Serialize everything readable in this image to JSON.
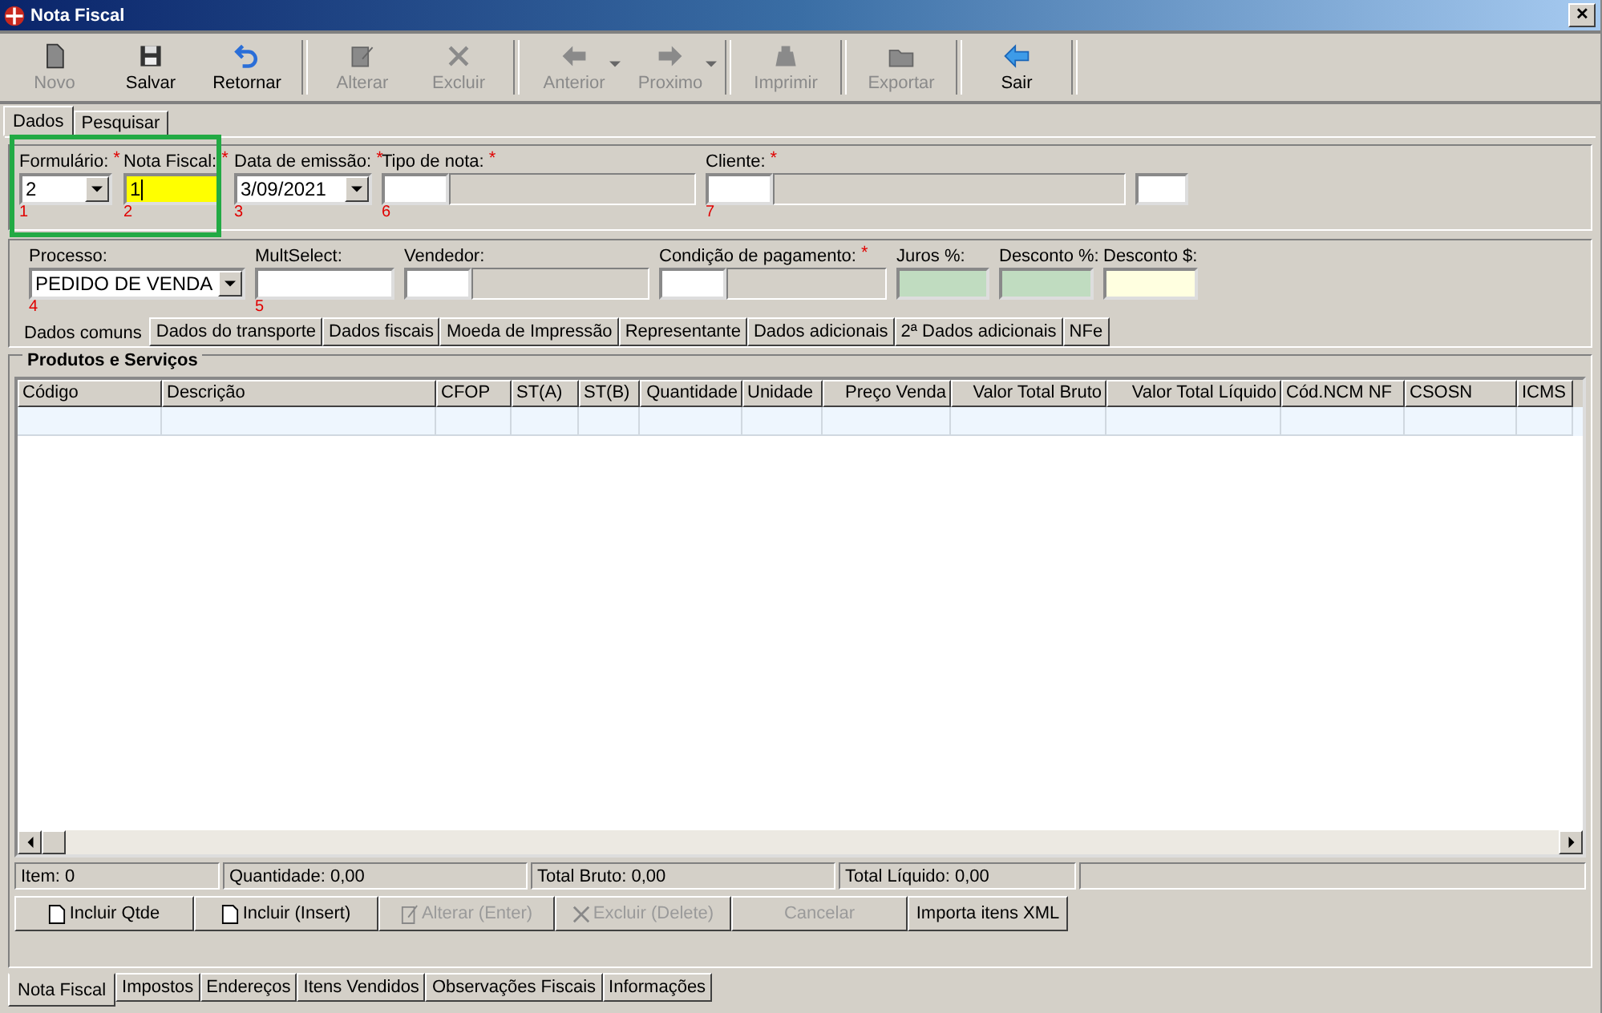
{
  "window": {
    "title": "Nota Fiscal",
    "close": "✕"
  },
  "toolbar": {
    "groups": [
      [
        {
          "label": "Novo",
          "kind": "doc",
          "disabled": true
        },
        {
          "label": "Salvar",
          "kind": "floppy",
          "disabled": false
        },
        {
          "label": "Retornar",
          "kind": "undo",
          "disabled": false
        }
      ],
      [
        {
          "label": "Alterar",
          "kind": "edit",
          "disabled": true
        },
        {
          "label": "Excluir",
          "kind": "x",
          "disabled": true
        }
      ],
      [
        {
          "label": "Anterior",
          "kind": "left",
          "disabled": true,
          "dropdown": true
        },
        {
          "label": "Proximo",
          "kind": "right",
          "disabled": true,
          "dropdown": true
        }
      ],
      [
        {
          "label": "Imprimir",
          "kind": "bag",
          "disabled": true
        }
      ],
      [
        {
          "label": "Exportar",
          "kind": "folder",
          "disabled": true
        }
      ],
      [
        {
          "label": "Sair",
          "kind": "back",
          "disabled": false
        }
      ]
    ]
  },
  "top_tabs": [
    {
      "label": "Dados",
      "selected": true
    },
    {
      "label": "Pesquisar",
      "selected": false
    }
  ],
  "header_fields": [
    {
      "label": "Formulário:",
      "kind": "combo",
      "value": "2",
      "mark": "*",
      "index": "1"
    },
    {
      "label": "Nota Fiscal:",
      "kind": "input",
      "value": "1",
      "color": "#ffff00",
      "focused": true,
      "mark": "*",
      "index": "2"
    },
    {
      "label": "Data de emissão:",
      "kind": "combo",
      "value": "3/09/2021",
      "mark": "*",
      "index": "3"
    },
    {
      "label": "Tipo de nota:",
      "kind": "split",
      "mark": "*",
      "index": "6"
    },
    {
      "label": "Cliente:",
      "kind": "split",
      "mark": "*",
      "index": "7"
    },
    {
      "kind": "input",
      "color": "#ffffff"
    }
  ],
  "detail_fields": [
    {
      "label": "Processo:",
      "kind": "combo",
      "value": "PEDIDO DE VENDA",
      "index": "4"
    },
    {
      "label": "MultSelect:",
      "kind": "input",
      "color": "#ffffff",
      "index": "5"
    },
    {
      "label": "Vendedor:",
      "kind": "split"
    },
    {
      "label": "Condição de pagamento:",
      "kind": "split",
      "mark": "*"
    },
    {
      "label": "Juros %:",
      "kind": "input",
      "color": "#c0dcc0"
    },
    {
      "label": "Desconto %:",
      "kind": "input",
      "color": "#c0dcc0"
    },
    {
      "label": "Desconto $:",
      "kind": "input",
      "color": "#ffffe0"
    }
  ],
  "detail_tabs": [
    {
      "label": "Dados comuns",
      "selected": true
    },
    {
      "label": "Dados do transporte",
      "selected": false
    },
    {
      "label": "Dados fiscais",
      "selected": false
    },
    {
      "label": "Moeda de Impressão",
      "selected": false
    },
    {
      "label": "Representante",
      "selected": false
    },
    {
      "label": "Dados adicionais",
      "selected": false
    },
    {
      "label": "2ª Dados adicionais",
      "selected": false
    },
    {
      "label": "NFe",
      "selected": false
    }
  ],
  "products": {
    "title": "Produtos e Serviços",
    "columns": [
      "Código",
      "Descrição",
      "CFOP",
      "ST(A)",
      "ST(B)",
      "Quantidade",
      "Unidade",
      "Preço Venda",
      "Valor Total Bruto",
      "Valor Total Líquido",
      "Cód.NCM NF",
      "CSOSN",
      "ICMS"
    ]
  },
  "status_bar": [
    "Item: 0",
    "Quantidade: 0,00",
    "Total Bruto: 0,00",
    "Total Líquido: 0,00"
  ],
  "item_buttons": [
    {
      "label": "Incluir Qtde",
      "kind": "doc",
      "disabled": false
    },
    {
      "label": "Incluir (Insert)",
      "kind": "doc",
      "disabled": false
    },
    {
      "label": "Alterar (Enter)",
      "kind": "edit",
      "disabled": true
    },
    {
      "label": "Excluir (Delete)",
      "kind": "x",
      "disabled": true
    },
    {
      "label": "Cancelar",
      "disabled": true
    },
    {
      "label": "Importa itens XML",
      "disabled": false
    }
  ],
  "bottom_tabs": [
    {
      "label": "Nota Fiscal",
      "selected": true
    },
    {
      "label": "Impostos",
      "selected": false
    },
    {
      "label": "Endereços",
      "selected": false
    },
    {
      "label": "Itens Vendidos",
      "selected": false
    },
    {
      "label": "Observações Fiscais",
      "selected": false
    },
    {
      "label": "Informações",
      "selected": false
    }
  ]
}
